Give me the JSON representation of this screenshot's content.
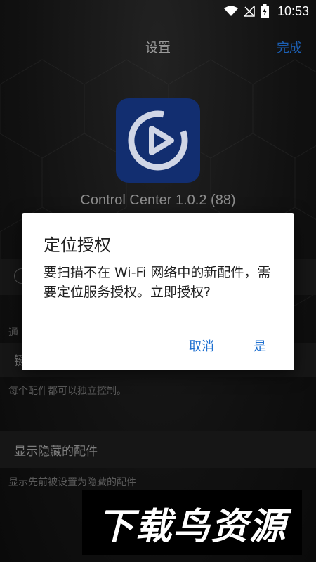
{
  "status_bar": {
    "time": "10:53",
    "icons": [
      "wifi-icon",
      "no-signal-icon",
      "battery-charging-icon"
    ]
  },
  "app_bar": {
    "title": "设置",
    "done_label": "完成"
  },
  "app": {
    "icon": "control-center-logo-icon",
    "version": "Control Center 1.0.2 (88)"
  },
  "settings": {
    "section_label": "通",
    "row2_char": "键",
    "note1": "每个配件都可以独立控制。",
    "hidden_accessories_label": "显示隐藏的配件",
    "note2": "显示先前被设置为隐藏的配件"
  },
  "dialog": {
    "title": "定位授权",
    "message": "要扫描不在 Wi-Fi 网络中的新配件，需要定位服务授权。立即授权?",
    "cancel_label": "取消",
    "confirm_label": "是"
  },
  "watermark": {
    "text": "下载鸟资源"
  },
  "colors": {
    "accent": "#1d6fd0",
    "app_icon_bg": "#122e70",
    "background": "#0c0c0c"
  }
}
